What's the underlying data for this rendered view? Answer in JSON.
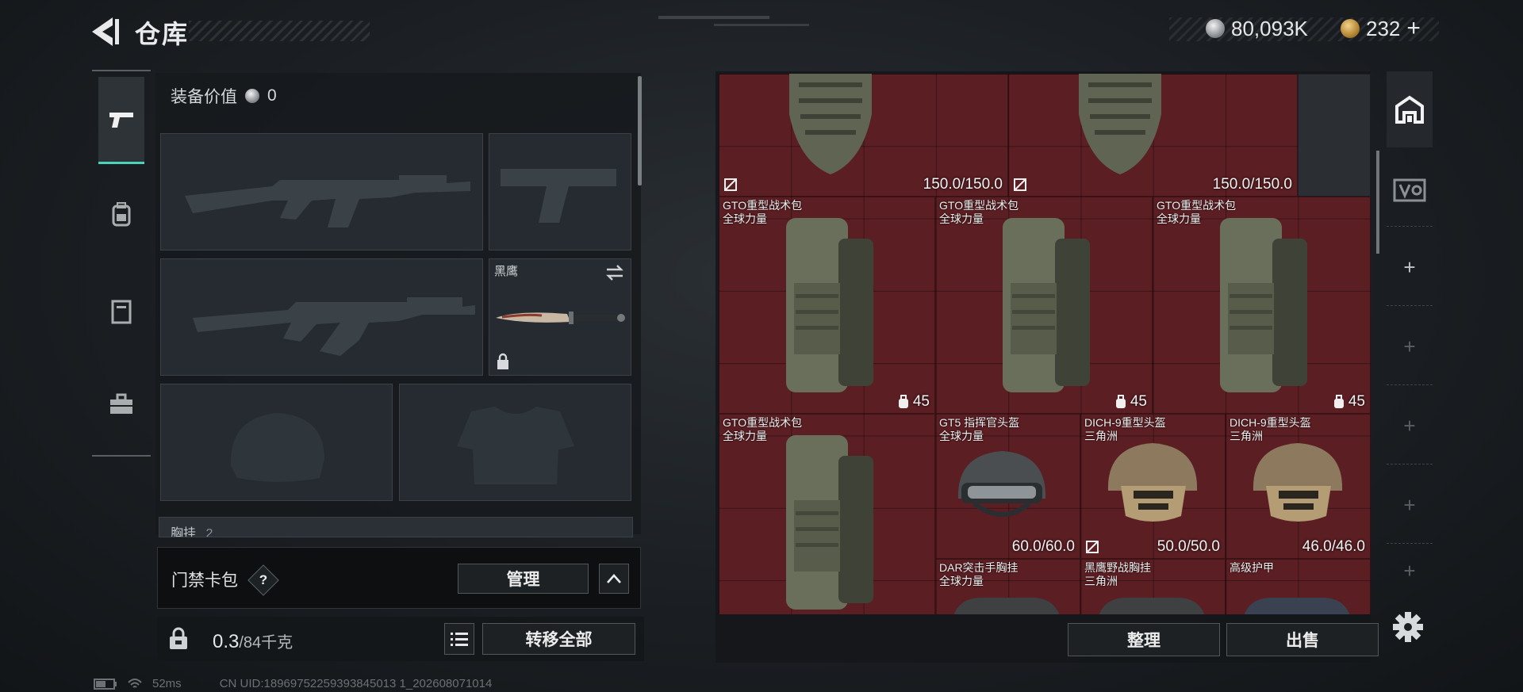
{
  "header": {
    "title": "仓库",
    "back_icon": "chevron-left-icon"
  },
  "currency": {
    "silver_amount": "80,093K",
    "gold_amount": "232",
    "gold_add": "+"
  },
  "left_tabs": [
    {
      "icon": "pistol-icon",
      "active": true
    },
    {
      "icon": "backpack-icon",
      "active": false
    },
    {
      "icon": "locker-icon",
      "active": false
    },
    {
      "icon": "briefcase-icon",
      "active": false
    }
  ],
  "loadout": {
    "equip_value_label": "装备价值",
    "equip_value": "0",
    "knife_slot_label": "黑鹰",
    "chest_row_label": "胸挂",
    "chest_row_count": "2"
  },
  "keycard": {
    "title": "门禁卡包",
    "help": "?",
    "manage_label": "管理"
  },
  "weight": {
    "current": "0.3",
    "max": "/84千克",
    "transfer_all_label": "转移全部"
  },
  "inventory": {
    "items": [
      {
        "name": "",
        "sub": "",
        "durability": "150.0/150.0",
        "kind": "armor"
      },
      {
        "name": "",
        "sub": "",
        "durability": "150.0/150.0",
        "kind": "armor"
      },
      {
        "name": "GTO重型战术包",
        "sub": "全球力量",
        "capacity": "45",
        "kind": "bag"
      },
      {
        "name": "GTO重型战术包",
        "sub": "全球力量",
        "capacity": "45",
        "kind": "bag"
      },
      {
        "name": "GTO重型战术包",
        "sub": "全球力量",
        "capacity": "45",
        "kind": "bag"
      },
      {
        "name": "GTO重型战术包",
        "sub": "全球力量",
        "capacity": "45",
        "kind": "bag"
      },
      {
        "name": "GT5 指挥官头盔",
        "sub": "全球力量",
        "durability": "60.0/60.0",
        "kind": "helmet"
      },
      {
        "name": "DICH-9重型头盔",
        "sub": "三角洲",
        "durability": "50.0/50.0",
        "kind": "helmet"
      },
      {
        "name": "DICH-9重型头盔",
        "sub": "三角洲",
        "durability": "46.0/46.0",
        "kind": "helmet"
      },
      {
        "name": "DAR突击手胸挂",
        "sub": "全球力量",
        "kind": "rig"
      },
      {
        "name": "黑鹰野战胸挂",
        "sub": "三角洲",
        "kind": "rig"
      },
      {
        "name": "高级护甲",
        "sub": "",
        "kind": "armor"
      }
    ],
    "sort_label": "整理",
    "sell_label": "出售"
  },
  "right_rail": {
    "add_symbol": "+"
  },
  "status_bar": {
    "ping": "52ms",
    "uid": "CN UID:18969752259393845013 1_202608071014"
  },
  "colors": {
    "accent": "#4ad3b9",
    "grid_bg": "#5b1e23"
  }
}
